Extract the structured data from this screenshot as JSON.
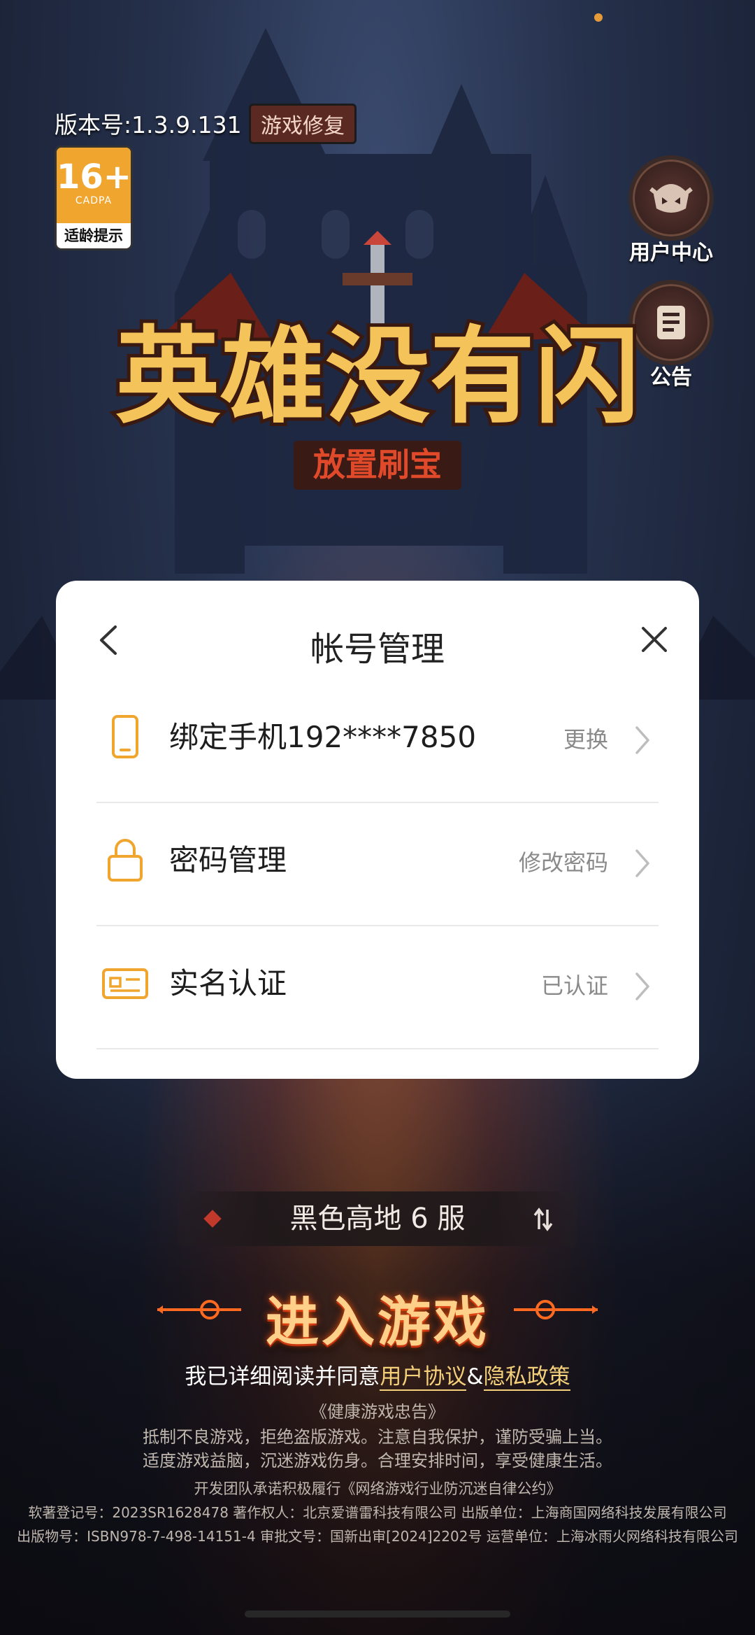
{
  "status": {
    "indicator_color": "#e59b3a"
  },
  "header": {
    "version": "版本号:1.3.9.131",
    "repair_label": "游戏修复",
    "age_rating": {
      "number": "16+",
      "org": "CADPA",
      "label": "适龄提示"
    }
  },
  "side_buttons": {
    "user_center": "用户中心",
    "notice": "公告"
  },
  "logo": {
    "title": "英雄没有闪",
    "subtitle": "放置刷宝"
  },
  "modal": {
    "title": "帐号管理",
    "rows": [
      {
        "label": "绑定手机192****7850",
        "value": "更换",
        "icon": "phone-icon"
      },
      {
        "label": "密码管理",
        "value": "修改密码",
        "icon": "lock-icon"
      },
      {
        "label": "实名认证",
        "value": "已认证",
        "icon": "id-card-icon"
      }
    ]
  },
  "server": {
    "name": "黑色高地 6 服"
  },
  "enter_button": "进入游戏",
  "agreement": {
    "prefix": "我已详细阅读并同意",
    "user_agreement": "用户协议",
    "and": "&",
    "privacy": "隐私政策"
  },
  "notices": [
    "《健康游戏忠告》",
    "抵制不良游戏，拒绝盗版游戏。注意自我保护，谨防受骗上当。",
    "适度游戏益脑，沉迷游戏伤身。合理安排时间，享受健康生活。",
    "开发团队承诺积极履行《网络游戏行业防沉迷自律公约》",
    "软著登记号：2023SR1628478 著作权人：北京爱谱雷科技有限公司 出版单位：上海商国网络科技发展有限公司",
    "出版物号：ISBN978-7-498-14151-4 审批文号：国新出审[2024]2202号 运营单位：上海冰雨火网络科技有限公司"
  ],
  "colors": {
    "accent_gold": "#f4d07a",
    "icon_orange": "#f0a52f",
    "modal_bg": "#ffffff"
  }
}
